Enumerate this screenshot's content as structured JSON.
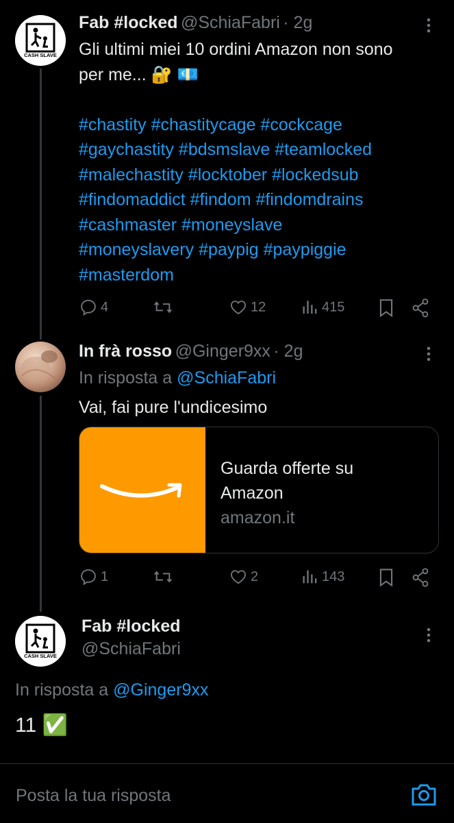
{
  "tweet1": {
    "name": "Fab #locked",
    "handle": "@SchiaFabri",
    "time": "· 2g",
    "text_line1": "Gli ultimi miei 10 ordini Amazon non sono",
    "text_line2": "per me... 🔐 💶",
    "hashtags": [
      "#chastity #chastitycage #cockcage",
      "#gaychastity #bdsmslave #teamlocked",
      "#malechastity #locktober #lockedsub",
      "#findomaddict #findom #findomdrains",
      "#cashmaster #moneyslave",
      "#moneyslavery #paypig #paypiggie",
      "#masterdom"
    ],
    "avatar_label": "CASH SLAVE",
    "replies": "4",
    "retweets": "",
    "likes": "12",
    "views": "415"
  },
  "tweet2": {
    "name": "In frà rosso",
    "handle": "@Ginger9xx",
    "time": "· 2g",
    "reply_to_prefix": "In risposta a",
    "reply_to_handle": "@SchiaFabri",
    "text": "Vai, fai pure l'undicesimo",
    "card": {
      "title_line1": "Guarda offerte su",
      "title_line2": "Amazon",
      "domain": "amazon.it"
    },
    "replies": "1",
    "retweets": "",
    "likes": "2",
    "views": "143"
  },
  "tweet3": {
    "name": "Fab #locked",
    "handle": "@SchiaFabri",
    "avatar_label": "CASH SLAVE",
    "reply_to_prefix": "In risposta a",
    "reply_to_handle": "@Ginger9xx",
    "text": "11 ✅"
  },
  "reply_bar": {
    "placeholder": "Posta la tua risposta"
  },
  "colors": {
    "accent": "#1d9bf0",
    "muted": "#71767b",
    "amazon_orange": "#ff9900"
  }
}
